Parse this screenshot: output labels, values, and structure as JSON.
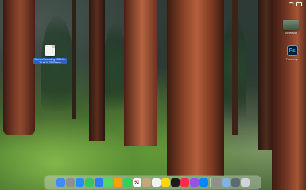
{
  "desktop": {
    "items": [
      {
        "label": "Screen Recording 2024-01-26 at 10.22.00.mov",
        "kind": "file",
        "selected": true
      },
      {
        "label": "Screenshot",
        "kind": "thumbnail",
        "selected": false
      },
      {
        "label": "Photoshop",
        "kind": "app",
        "selected": false
      }
    ]
  },
  "dock": {
    "apps": [
      {
        "name": "Finder",
        "icon": "finder-icon",
        "color": "#3a8ef6"
      },
      {
        "name": "Launchpad",
        "icon": "launchpad-icon",
        "color": "#8e8e93"
      },
      {
        "name": "Safari",
        "icon": "safari-icon",
        "color": "#1e90ff"
      },
      {
        "name": "Messages",
        "icon": "messages-icon",
        "color": "#34c759"
      },
      {
        "name": "Mail",
        "icon": "mail-icon",
        "color": "#2b7cff"
      },
      {
        "name": "Maps",
        "icon": "maps-icon",
        "color": "#4cd964"
      },
      {
        "name": "Photos",
        "icon": "photos-icon",
        "color": "#ff9f0a"
      },
      {
        "name": "FaceTime",
        "icon": "facetime-icon",
        "color": "#30d158"
      },
      {
        "name": "Calendar",
        "icon": "calendar-icon",
        "color": "#ffffff",
        "month": "JAN",
        "day": "24"
      },
      {
        "name": "Contacts",
        "icon": "contacts-icon",
        "color": "#c7a57a"
      },
      {
        "name": "Reminders",
        "icon": "reminders-icon",
        "color": "#f2f2f2"
      },
      {
        "name": "Notes",
        "icon": "notes-icon",
        "color": "#ffd60a"
      },
      {
        "name": "Apple TV",
        "icon": "tv-icon",
        "color": "#1c1c1e"
      },
      {
        "name": "Music",
        "icon": "music-icon",
        "color": "#fa2d48"
      },
      {
        "name": "Podcasts",
        "icon": "podcasts-icon",
        "color": "#9b51e0"
      },
      {
        "name": "App Store",
        "icon": "appstore-icon",
        "color": "#0a84ff"
      },
      {
        "name": "System Settings",
        "icon": "settings-icon",
        "color": "#8e8e93"
      },
      {
        "name": "Preview",
        "icon": "preview-icon",
        "color": "#7fb3e8"
      },
      {
        "name": "Screenshot",
        "icon": "screenshot-icon",
        "color": "#5e6a73"
      },
      {
        "name": "Trash",
        "icon": "trash-icon",
        "color": "#d0d4d8"
      }
    ]
  }
}
